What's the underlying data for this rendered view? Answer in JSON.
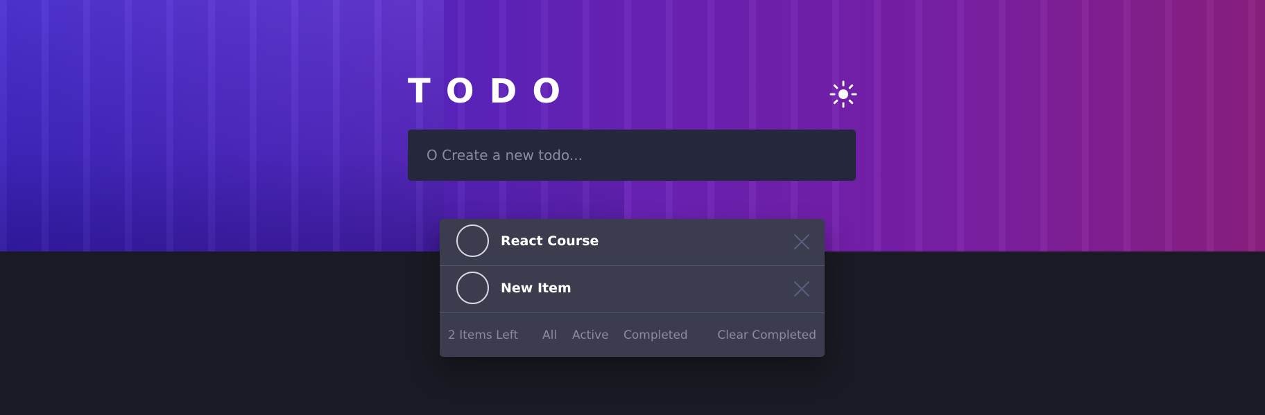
{
  "app": {
    "title": "TODO"
  },
  "theme_toggle": {
    "icon": "sun-icon"
  },
  "new_todo": {
    "placeholder": "O Create a new todo...",
    "value": ""
  },
  "todos": [
    {
      "text": "React Course",
      "completed": false
    },
    {
      "text": "New Item",
      "completed": false
    }
  ],
  "footer": {
    "items_left": "2 Items Left",
    "filters": [
      "All",
      "Active",
      "Completed"
    ],
    "clear_label": "Clear Completed"
  },
  "colors": {
    "hero_gradient_start": "#3a1fc2",
    "hero_gradient_end": "#8c1f80",
    "page_background": "#1a1a24",
    "input_background": "#25273c",
    "card_background": "#3b3d4e"
  }
}
